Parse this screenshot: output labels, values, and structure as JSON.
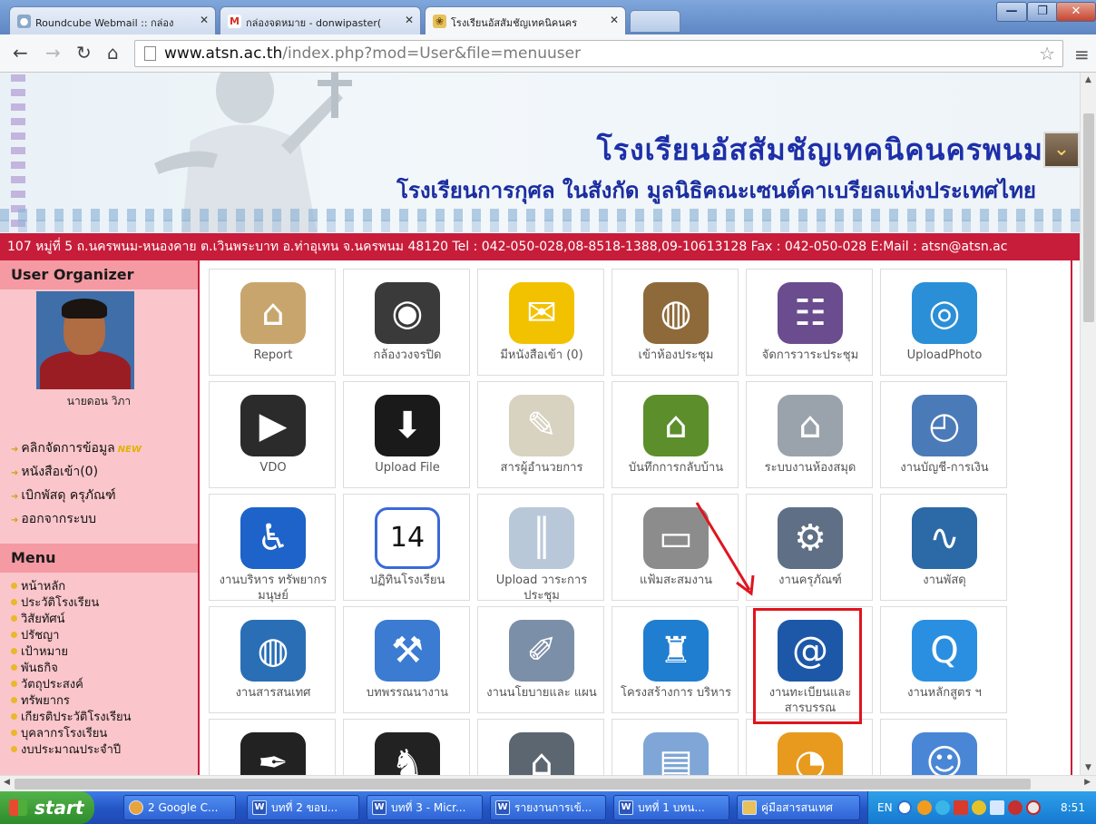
{
  "browser": {
    "tabs": [
      {
        "label": "Roundcube Webmail :: กล่อง",
        "icon": "roundcube-icon"
      },
      {
        "label": "กล่องจดหมาย - donwipaster(",
        "icon": "gmail-icon"
      },
      {
        "label": "โรงเรียนอัสสัมชัญเทคนิคนคร",
        "icon": "school-favicon-icon"
      }
    ],
    "url_host": "www.atsn.ac.th",
    "url_path": "/index.php?mod=User&file=menuuser"
  },
  "banner": {
    "title": "โรงเรียนอัสสัมชัญเทคนิคนครพนม",
    "subtitle": "โรงเรียนการกุศล ในสังกัด มูลนิธิคณะเซนต์คาเบรียลแห่งประเทศไทย",
    "address": "107 หมู่ที่ 5 ถ.นครพนม-หนองคาย ต.เวินพระบาท อ.ท่าอุเทน จ.นครพนม 48120 Tel : 042-050-028,08-8518-1388,09-10613128 Fax : 042-050-028 E:Mail : atsn@atsn.ac"
  },
  "sidebar": {
    "organizer_heading": "User Organizer",
    "user_name": "นายดอน วิภา",
    "links": [
      "คลิกจัดการข้อมูล",
      "หนังสือเข้า(0)",
      "เบิกพัสดุ ครุภัณฑ์",
      "ออกจากระบบ"
    ],
    "new_badge": "NEW",
    "menu_heading": "Menu",
    "menu_items": [
      "หน้าหลัก",
      "ประวัติโรงเรียน",
      "วิสัยทัศน์",
      "ปรัชญา",
      "เป้าหมาย",
      "พันธกิจ",
      "วัตถุประสงค์",
      "ทรัพยากร",
      "เกียรติประวัติโรงเรียน",
      "บุคลากรโรงเรียน",
      "งบประมาณประจำปี"
    ]
  },
  "grid": {
    "tiles": [
      {
        "label": "Report",
        "icon": "house-icon",
        "color": "#c9a56e"
      },
      {
        "label": "กล้องวงจรปิด",
        "icon": "cctv-icon",
        "color": "#3a3a3a"
      },
      {
        "label": "มีหนังสือเข้า (0)",
        "icon": "mail-envelope-icon",
        "color": "#f2c200"
      },
      {
        "label": "เข้าห้องประชุม",
        "icon": "meeting-table-icon",
        "color": "#8e6a3b"
      },
      {
        "label": "จัดการวาระประชุม",
        "icon": "meeting-agenda-icon",
        "color": "#6a4c8f"
      },
      {
        "label": "UploadPhoto",
        "icon": "camera-icon",
        "color": "#2a8fd6"
      },
      {
        "label": "VDO",
        "icon": "video-camera-icon",
        "color": "#2b2b2b"
      },
      {
        "label": "Upload File",
        "icon": "blackberry-download-icon",
        "color": "#1a1a1a"
      },
      {
        "label": "สารผู้อำนวยการ",
        "icon": "letter-pen-icon",
        "color": "#d8d2c0"
      },
      {
        "label": "บันทึกการกลับบ้าน",
        "icon": "green-book-house-icon",
        "color": "#5c8e2c"
      },
      {
        "label": "ระบบงานห้องสมุด",
        "icon": "home-screen-icon",
        "color": "#9aa3ab"
      },
      {
        "label": "งานบัญชี-การเงิน",
        "icon": "gauge-icon",
        "color": "#4b7ab8"
      },
      {
        "label": "งานบริหาร ทรัพยากรมนุษย์",
        "icon": "accessibility-icon",
        "color": "#1d63c9"
      },
      {
        "label": "ปฏิทินโรงเรียน",
        "icon": "calendar-icon",
        "color": "#3a6ad8",
        "text": "14"
      },
      {
        "label": "Upload วาระการ ประชุม",
        "icon": "zipper-icon",
        "color": "#b9c8d8"
      },
      {
        "label": "แฟ้มสะสมงาน",
        "icon": "hard-drive-icon",
        "color": "#8c8c8c"
      },
      {
        "label": "งานครุภัณฑ์",
        "icon": "settings-gears-icon",
        "color": "#5e6f86"
      },
      {
        "label": "งานพัสดุ",
        "icon": "activity-monitor-icon",
        "color": "#2b6aa6"
      },
      {
        "label": "งานสารสนเทศ",
        "icon": "globe-icon",
        "color": "#2a6fb5"
      },
      {
        "label": "บทพรรณนางาน",
        "icon": "xcode-tools-icon",
        "color": "#3b7bd1"
      },
      {
        "label": "งานนโยบายและ แผน",
        "icon": "scroll-paper-icon",
        "color": "#7c8fa8"
      },
      {
        "label": "โครงสร้างการ บริหาร",
        "icon": "armchair-icon",
        "color": "#1f7ed0"
      },
      {
        "label": "งานทะเบียนและ สารบรรณ",
        "icon": "address-book-icon",
        "color": "#1d58a8"
      },
      {
        "label": "งานหลักสูตร ฯ",
        "icon": "quicktime-icon",
        "color": "#2a8fe0"
      },
      {
        "label": "",
        "icon": "ink-bottle-icon",
        "color": "#222"
      },
      {
        "label": "",
        "icon": "chess-knight-icon",
        "color": "#222"
      },
      {
        "label": "",
        "icon": "house-roof-icon",
        "color": "#5c6670"
      },
      {
        "label": "",
        "icon": "folder-icon",
        "color": "#7fa6d6"
      },
      {
        "label": "",
        "icon": "rss-feed-icon",
        "color": "#e89a1e"
      },
      {
        "label": "",
        "icon": "finder-icon",
        "color": "#4a86d6"
      }
    ]
  },
  "taskbar": {
    "start": "start",
    "tasks": [
      {
        "label": "2 Google C...",
        "icon": "chrome-icon"
      },
      {
        "label": "บทที่ 2 ขอบ...",
        "icon": "word-icon"
      },
      {
        "label": "บทที่ 3 - Micr...",
        "icon": "word-icon"
      },
      {
        "label": "รายงานการเข้...",
        "icon": "word-icon"
      },
      {
        "label": "บทที่ 1 บทน...",
        "icon": "word-icon"
      },
      {
        "label": "คู่มือสารสนเทศ",
        "icon": "folder-icon"
      }
    ],
    "lang": "EN",
    "clock": "8:51"
  }
}
